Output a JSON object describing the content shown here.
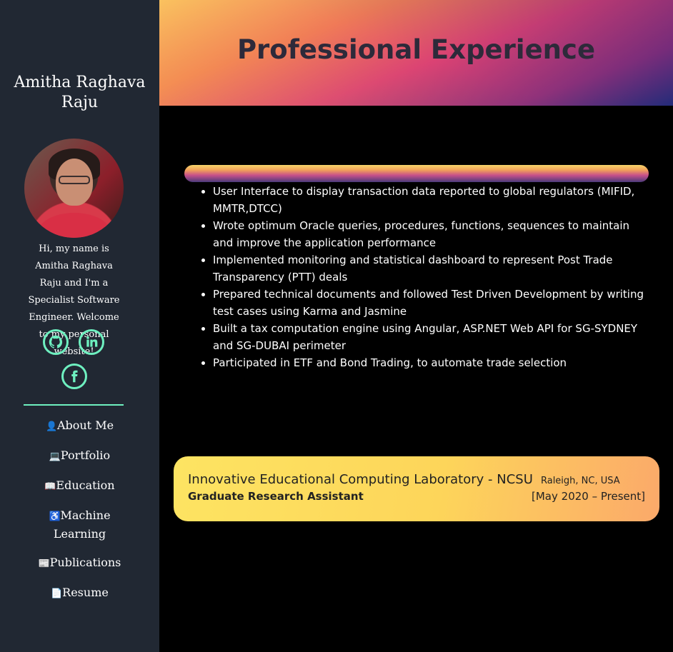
{
  "sidebar": {
    "name": "Amitha Raghava Raju",
    "intro": "Hi, my name is Amitha Raghava Raju and I'm a Specialist Software Engineer. Welcome to my personal website!",
    "socials": [
      "github-icon",
      "linkedin-icon",
      "facebook-icon"
    ],
    "nav": [
      {
        "label": "About Me",
        "icon": "user-icon"
      },
      {
        "label": "Portfolio",
        "icon": "laptop-icon"
      },
      {
        "label": "Education",
        "icon": "book-icon"
      },
      {
        "label": "Machine Learning",
        "icon": "universal-access-icon"
      },
      {
        "label": "Publications",
        "icon": "newspaper-icon"
      },
      {
        "label": "Resume",
        "icon": "file-icon"
      }
    ]
  },
  "header": {
    "title": "Professional Experience"
  },
  "experience": {
    "bullets": [
      "User Interface to display transaction data reported to global regulators (MIFID, MMTR,DTCC)",
      "Wrote optimum Oracle queries, procedures, functions, sequences to maintain and improve the application performance",
      "Implemented monitoring and statistical dashboard to represent Post Trade Transparency (PTT) deals",
      "Prepared technical documents and followed Test Driven Development by writing test cases using Karma and Jasmine",
      "Built a tax computation engine using Angular, ASP.NET Web API for SG-SYDNEY and SG-DUBAI perimeter",
      "Participated in ETF and Bond Trading, to automate trade selection"
    ],
    "card": {
      "organization": "Innovative Educational Computing Laboratory - NCSU",
      "location": "Raleigh, NC, USA",
      "role": "Graduate Research Assistant",
      "dates": "[May 2020 – Present]"
    }
  },
  "colors": {
    "sidebar_bg": "#212833",
    "accent": "#6ef0c0",
    "page_bg": "#000000"
  }
}
